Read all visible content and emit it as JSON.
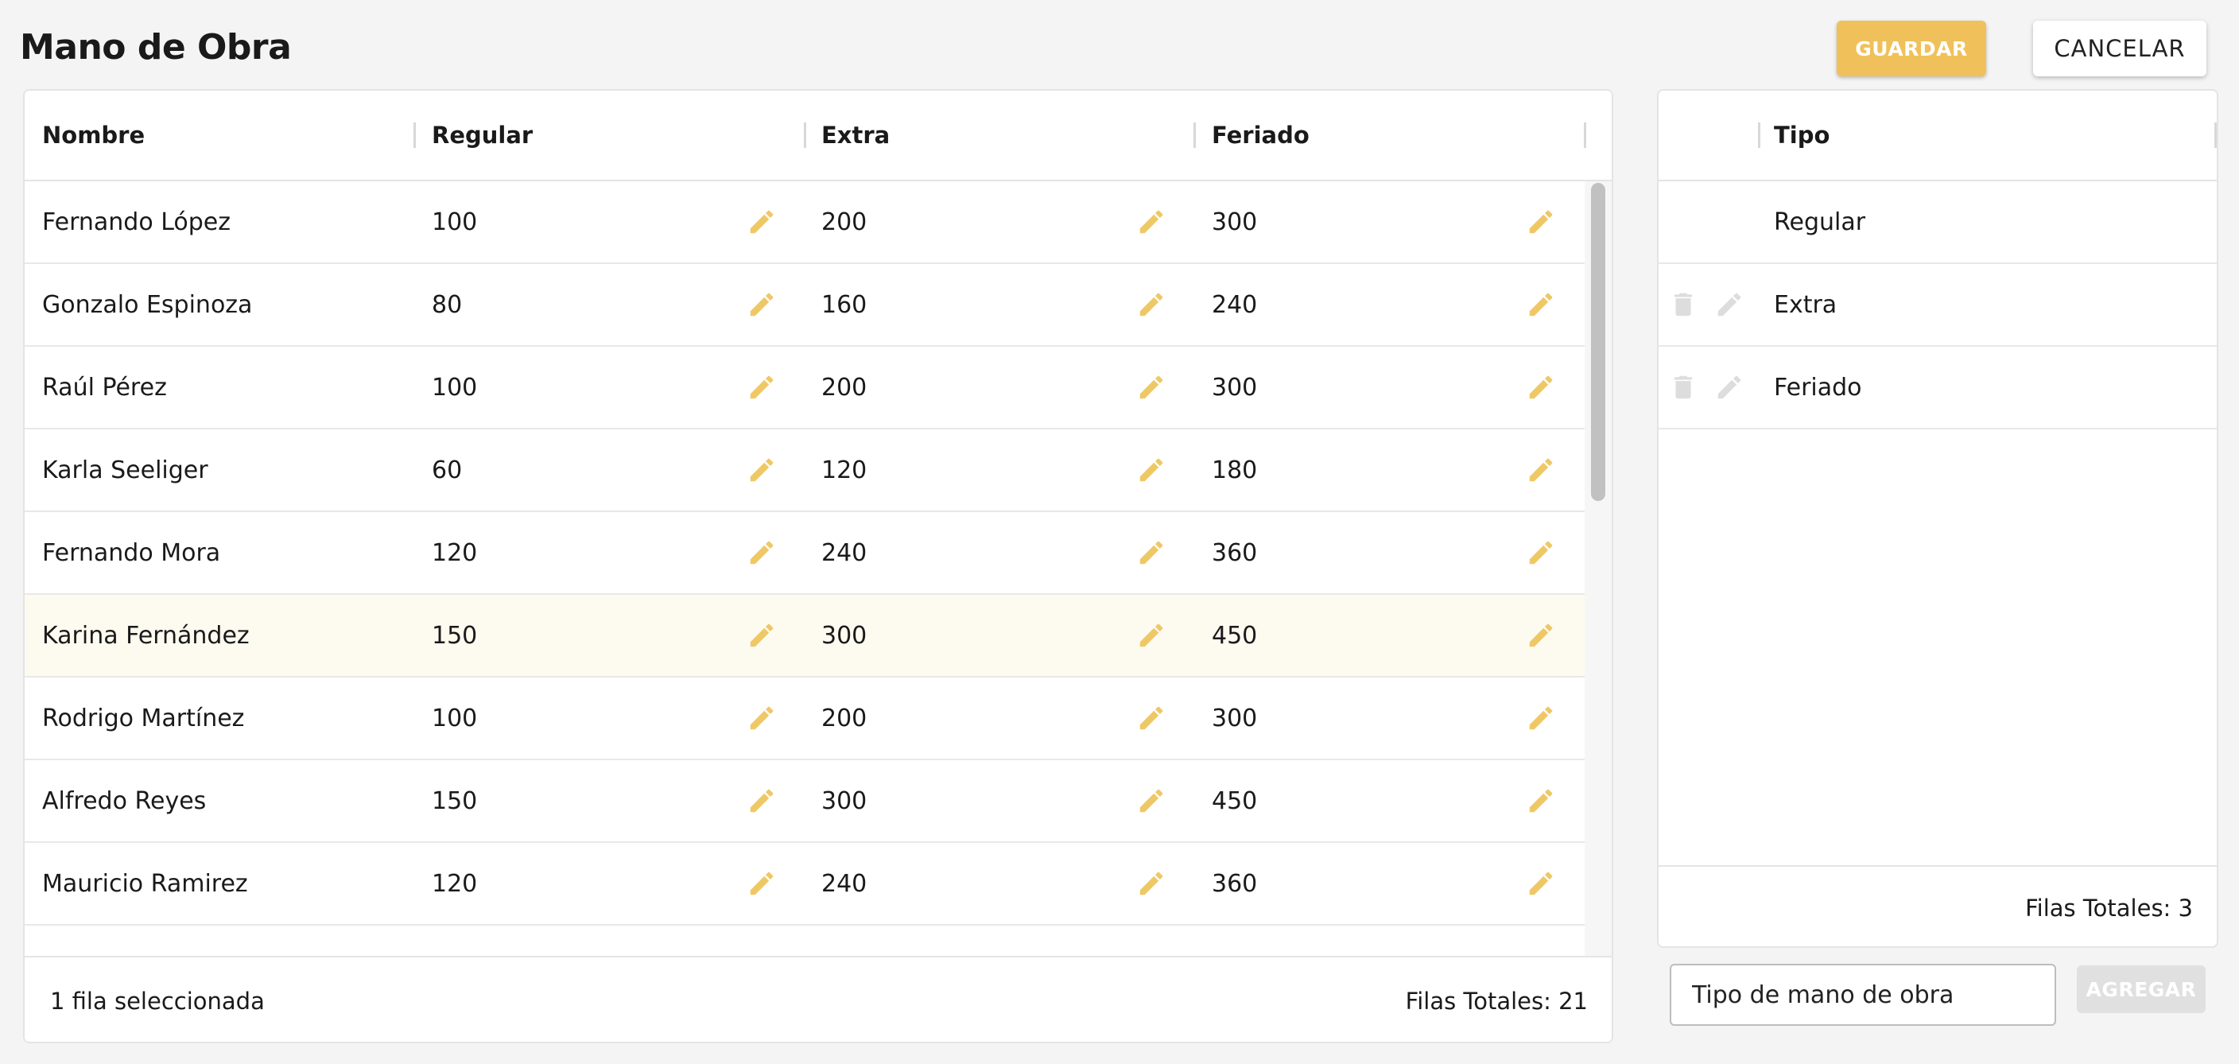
{
  "page": {
    "title": "Mano de Obra"
  },
  "actions": {
    "save_label": "GUARDAR",
    "cancel_label": "CANCELAR"
  },
  "labor_grid": {
    "columns": [
      "Nombre",
      "Regular",
      "Extra",
      "Feriado"
    ],
    "rows": [
      {
        "name": "Fernando López",
        "regular": "100",
        "extra": "200",
        "holiday": "300"
      },
      {
        "name": "Gonzalo Espinoza",
        "regular": "80",
        "extra": "160",
        "holiday": "240"
      },
      {
        "name": "Raúl Pérez",
        "regular": "100",
        "extra": "200",
        "holiday": "300"
      },
      {
        "name": "Karla Seeliger",
        "regular": "60",
        "extra": "120",
        "holiday": "180"
      },
      {
        "name": "Fernando Mora",
        "regular": "120",
        "extra": "240",
        "holiday": "360"
      },
      {
        "name": "Karina Fernández",
        "regular": "150",
        "extra": "300",
        "holiday": "450"
      },
      {
        "name": "Rodrigo Martínez",
        "regular": "100",
        "extra": "200",
        "holiday": "300"
      },
      {
        "name": "Alfredo Reyes",
        "regular": "150",
        "extra": "300",
        "holiday": "450"
      },
      {
        "name": "Mauricio Ramirez",
        "regular": "120",
        "extra": "240",
        "holiday": "360"
      }
    ],
    "selected_label": "1 fila seleccionada",
    "total_label": "Filas Totales: 21"
  },
  "type_grid": {
    "column": "Tipo",
    "rows": [
      {
        "type": "Regular"
      },
      {
        "type": "Extra"
      },
      {
        "type": "Feriado"
      }
    ],
    "total_label": "Filas Totales: 3"
  },
  "add_form": {
    "placeholder": "Tipo de mano de obra",
    "add_label": "AGREGAR"
  },
  "colors": {
    "accent": "#f0c15a",
    "icon_edit": "#efc866",
    "icon_disabled": "#dddddd",
    "selected_row": "#fdfaf0"
  },
  "icons": {
    "edit": "pencil-icon",
    "delete": "trash-icon"
  }
}
